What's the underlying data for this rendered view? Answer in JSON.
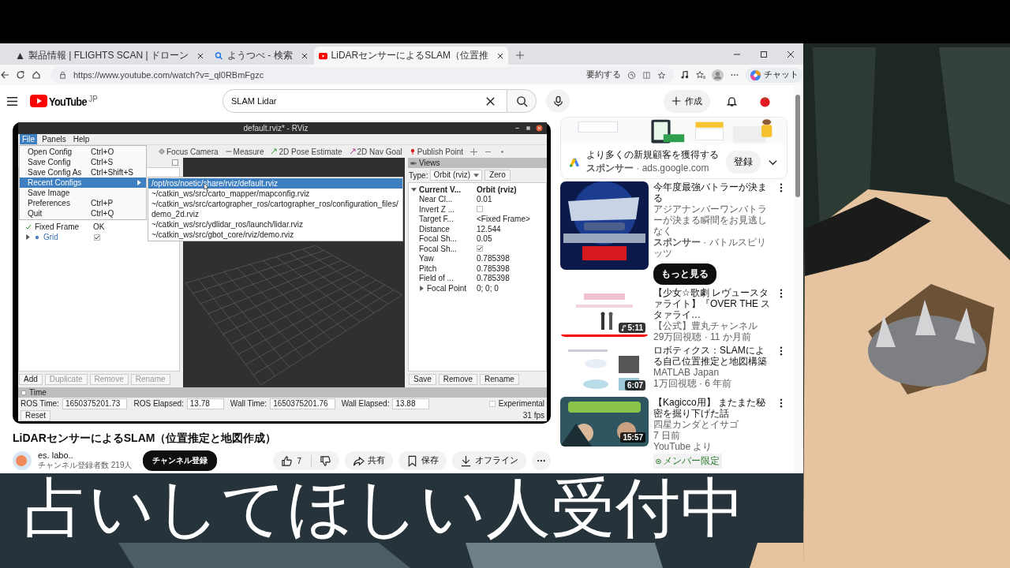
{
  "browser": {
    "tabs": [
      {
        "kind": "site",
        "title": "製品情報 | FLIGHTS SCAN | ドローン",
        "selected": false
      },
      {
        "kind": "search",
        "title": "ようつべ - 検索",
        "selected": false
      },
      {
        "kind": "video",
        "title": "LiDARセンサーによるSLAM（位置推",
        "selected": true
      }
    ],
    "url": "https://www.youtube.com/watch?v=_ql0RBmFgzc",
    "summarize": "要約する",
    "chat": "チャット"
  },
  "youtube": {
    "logo": "YouTube",
    "region": "JP",
    "search": {
      "value": "SLAM Lidar"
    },
    "create": "作成"
  },
  "player": {
    "rviz": {
      "title": "default.rviz* - RViz",
      "menus": [
        {
          "label": "File",
          "selected": true
        },
        {
          "label": "Panels",
          "selected": false
        },
        {
          "label": "Help",
          "selected": false
        }
      ],
      "file_menu": [
        {
          "label": "Open Config",
          "shortcut": "Ctrl+O",
          "submenu": false,
          "selected": false
        },
        {
          "label": "Save Config",
          "shortcut": "Ctrl+S",
          "submenu": false,
          "selected": false
        },
        {
          "label": "Save Config As",
          "shortcut": "Ctrl+Shift+S",
          "submenu": false,
          "selected": false
        },
        {
          "label": "Recent Configs",
          "submenu": true,
          "selected": true
        },
        {
          "label": "Save Image",
          "submenu": false,
          "selected": false
        },
        {
          "label": "Preferences",
          "shortcut": "Ctrl+P",
          "submenu": false,
          "selected": false
        },
        {
          "label": "Quit",
          "shortcut": "Ctrl+Q",
          "submenu": false,
          "selected": false
        }
      ],
      "recent_configs": [
        {
          "path": "/opt/ros/noetic/share/rviz/default.rviz",
          "selected": true
        },
        {
          "path": "~/catkin_ws/src/carto_mapper/mapconfig.rviz",
          "selected": false
        },
        {
          "path": "~/catkin_ws/src/cartographer_ros/cartographer_ros/configuration_files/demo_2d.rviz",
          "selected": false
        },
        {
          "path": "~/catkin_ws/src/ydlidar_ros/launch/lidar.rviz",
          "selected": false
        },
        {
          "path": "~/catkin_ws/src/gbot_core/rviz/demo.rviz",
          "selected": false
        }
      ],
      "tools": [
        {
          "kind": "focus",
          "label": "Focus Camera"
        },
        {
          "kind": "measure",
          "label": "Measure"
        },
        {
          "kind": "pose",
          "label": "2D Pose Estimate"
        },
        {
          "kind": "goal",
          "label": "2D Nav Goal"
        },
        {
          "kind": "point",
          "label": "Publish Point"
        }
      ],
      "displays": {
        "items": [
          {
            "kind": "status",
            "name": "Fixed Frame",
            "value": "OK"
          },
          {
            "kind": "display",
            "name": "Grid",
            "expanded": false,
            "checked": true
          }
        ],
        "buttons": [
          {
            "label": "Add",
            "disabled": false
          },
          {
            "label": "Duplicate",
            "disabled": true
          },
          {
            "label": "Remove",
            "disabled": true
          },
          {
            "label": "Rename",
            "disabled": true
          }
        ]
      },
      "views": {
        "title": "Views",
        "type_label": "Type:",
        "type": "Orbit (rviz)",
        "zero": "Zero",
        "tree": {
          "name": "Current V...",
          "value": "Orbit (rviz)",
          "expanded": true,
          "children": [
            {
              "kind": "text",
              "name": "Near Cl...",
              "value": "0.01"
            },
            {
              "kind": "check",
              "name": "Invert Z ...",
              "checked": false
            },
            {
              "kind": "text",
              "name": "Target F...",
              "value": "<Fixed Frame>"
            },
            {
              "kind": "text",
              "name": "Distance",
              "value": "12.544"
            },
            {
              "kind": "text",
              "name": "Focal Sh...",
              "value": "0.05"
            },
            {
              "kind": "check",
              "name": "Focal Sh...",
              "checked": true
            },
            {
              "kind": "text",
              "name": "Yaw",
              "value": "0.785398"
            },
            {
              "kind": "text",
              "name": "Pitch",
              "value": "0.785398"
            },
            {
              "kind": "text",
              "name": "Field of ...",
              "value": "0.785398"
            },
            {
              "kind": "group",
              "name": "Focal Point",
              "value": "0; 0; 0",
              "expanded": false
            }
          ]
        },
        "buttons": [
          "Save",
          "Remove",
          "Rename"
        ]
      },
      "time": {
        "title": "Time",
        "fields": [
          {
            "label": "ROS Time:",
            "value": "1650375201.73"
          },
          {
            "label": "ROS Elapsed:",
            "value": "13.78"
          },
          {
            "label": "Wall Time:",
            "value": "1650375201.76"
          },
          {
            "label": "Wall Elapsed:",
            "value": "13.88"
          }
        ],
        "experimental": {
          "label": "Experimental",
          "checked": false
        },
        "reset": "Reset",
        "fps": "31 fps"
      }
    }
  },
  "video": {
    "title": "LiDARセンサーによるSLAM（位置推定と地図作成）",
    "channel": "es. labo..",
    "subscribers": "チャンネル登録者数 219人",
    "subscribe": "チャンネル登録",
    "likes": "7",
    "actions": [
      {
        "kind": "share",
        "label": "共有"
      },
      {
        "kind": "save",
        "label": "保存"
      },
      {
        "kind": "download",
        "label": "オフライン"
      }
    ]
  },
  "sidebar": {
    "ad": {
      "kind": "picture",
      "title": "より多くの新規顧客を獲得する",
      "sponsor": "**スポンサー** · ads.google.com",
      "button": "登録"
    },
    "promo": {
      "kind": "picture",
      "title": "今年度最強バトラーが決まる",
      "description": "アジアナンバーワンバトラーが決まる瞬間をお見逃しなく",
      "sponsor": "**スポンサー** · バトルスピリッツ",
      "button": "もっと見る"
    },
    "videos": [
      {
        "title": "【少女☆歌劇 レヴュースタァライト】『OVER THE スタァライ…",
        "channel": "【公式】豊丸チャンネル",
        "meta": "29万回視聴 · 11 か月前",
        "duration": "5:11",
        "music": true,
        "level": 1
      },
      {
        "title": "ロボティクス：SLAMによる自己位置推定と地図構築",
        "channel": "MATLAB Japan",
        "meta": "1万回視聴 · 6 年前",
        "duration": "6:07",
        "music": false
      },
      {
        "title": "【Kagicco用】 またまた秘密を掘り下げた話",
        "channel": "四星カンダとイサゴ",
        "meta": "7 日前",
        "source": "YouTube より",
        "badge": "メンバー限定",
        "duration": "15:57",
        "music": false
      }
    ]
  },
  "overlay": {
    "caption": "占いしてほしい人受付中"
  }
}
